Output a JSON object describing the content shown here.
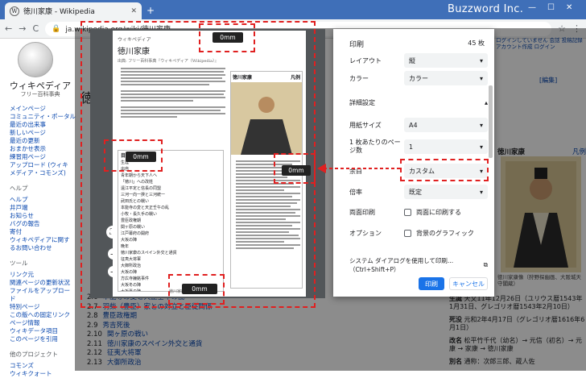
{
  "browser": {
    "tab_title": "徳川家康 - Wikipedia",
    "brand": "Buzzword Inc.",
    "url": "ja.wikipedia.org/wiki/徳川家康",
    "nav_back": "←",
    "nav_forward": "→",
    "nav_reload": "C",
    "new_tab": "+",
    "win_controls": [
      "—",
      "☐",
      "✕"
    ]
  },
  "wiki": {
    "site_title": "ウィキペディア",
    "site_sub": "フリー百科事典",
    "article_title": "徳川家康",
    "nav_main": [
      "メインページ",
      "コミュニティ・ポータル",
      "最近の出来事",
      "新しいページ",
      "最近の更新",
      "おまかせ表示",
      "練習用ページ",
      "アップロード (ウィキメディア・コモンズ)"
    ],
    "help_heading": "ヘルプ",
    "nav_help": [
      "ヘルプ",
      "井戸端",
      "お知らせ",
      "バグの報告",
      "寄付",
      "ウィキペディアに関するお問い合わせ"
    ],
    "tools_heading": "ツール",
    "nav_tools": [
      "リンク元",
      "関連ページの更新状況",
      "ファイルをアップロード",
      "特別ページ",
      "この版への固定リンク",
      "ページ情報",
      "ウィキデータ項目",
      "このページを引用"
    ],
    "other_heading": "他のプロジェクト",
    "nav_other": [
      "コモンズ",
      "ウィキクォート"
    ],
    "toc": [
      {
        "n": "2.6",
        "t": "本能寺の変と天正壬午の乱"
      },
      {
        "n": "2.7",
        "t": "羽柴（豊臣）家との対立と臣従関係"
      },
      {
        "n": "2.8",
        "t": "豊臣政権期"
      },
      {
        "n": "2.9",
        "t": "秀吉死後"
      },
      {
        "n": "2.10",
        "t": "関ヶ原の戦い"
      },
      {
        "n": "2.11",
        "t": "徳川家康のスペイン外交と通貨"
      },
      {
        "n": "2.12",
        "t": "征夷大将軍"
      },
      {
        "n": "2.13",
        "t": "大御所政治"
      }
    ],
    "top_links": "ログインしていません 会話 投稿記録 アカウント作成 ログイン",
    "infobox_title": "徳川家康",
    "infobox_right": "凡例",
    "birth_label": "生誕",
    "birth_value": "天文11年12月26日（ユリウス暦1543年1月31日、グレゴリオ暦1543年2月10日）",
    "death_label": "死没",
    "death_value": "元和2年4月17日（グレゴリオ暦1616年6月1日）",
    "rename_label": "改名",
    "rename_value": "松平竹千代（幼名）→ 元信（初名）→ 元康 → 家康 → 徳川家康",
    "alias_label": "別名",
    "alias_value": "通称：次郎三郎、蔵人佐",
    "caption": "徳川家康像（狩野探幽画、大阪城天守閣蔵）"
  },
  "preview": {
    "page_header": "ウィキペディア",
    "page_title": "徳川家康",
    "page_subtitle": "出典: フリー百科事典『ウィキペディア（Wikipedia）』",
    "infobox_title": "徳川家康",
    "infobox_right": "凡例",
    "toc_heading": "目次",
    "toc_items": [
      "生涯",
      "出自",
      "青年期から天下人へ",
      "「徳川」への改姓",
      "遠江平定と信長の同盟",
      "三河一向一揆と三河統一",
      "武田氏との戦い",
      "本能寺の変と天正壬午の乱",
      "小牧・長久手の戦い",
      "豊臣政権期",
      "関ヶ原の戦い",
      "江戸幕府の開府",
      "大坂の陣",
      "晩年",
      "徳川家康のスペイン外交と通貨",
      "征夷大将軍",
      "大御所政治",
      "大坂の陣",
      "方広寺鐘銘事件",
      "大坂冬の陣",
      "大坂夏の陣",
      "最期",
      "死因"
    ],
    "page_footer": "徳川家康 - Wikipedia"
  },
  "badges": {
    "top": "0mm",
    "left": "0mm",
    "right": "0mm",
    "bottom": "0mm"
  },
  "print": {
    "title": "印刷",
    "sheets": "45 枚",
    "layout_label": "レイアウト",
    "layout_value": "縦",
    "color_label": "カラー",
    "color_value": "カラー",
    "details_label": "詳細設定",
    "paper_label": "用紙サイズ",
    "paper_value": "A4",
    "pps_label": "1 枚あたりのページ数",
    "pps_value": "1",
    "margin_label": "余白",
    "margin_value": "カスタム",
    "scale_label": "倍率",
    "scale_value": "既定",
    "duplex_label": "両面印刷",
    "duplex_option": "両面に印刷する",
    "options_label": "オプション",
    "bg_option": "背景のグラフィック",
    "system_dialog": "システム ダイアログを使用して印刷...（Ctrl+Shift+P）",
    "print_button": "印刷",
    "cancel_button": "キャンセル"
  },
  "accent_color": "#1a73e8",
  "annotation_color": "#e02020"
}
